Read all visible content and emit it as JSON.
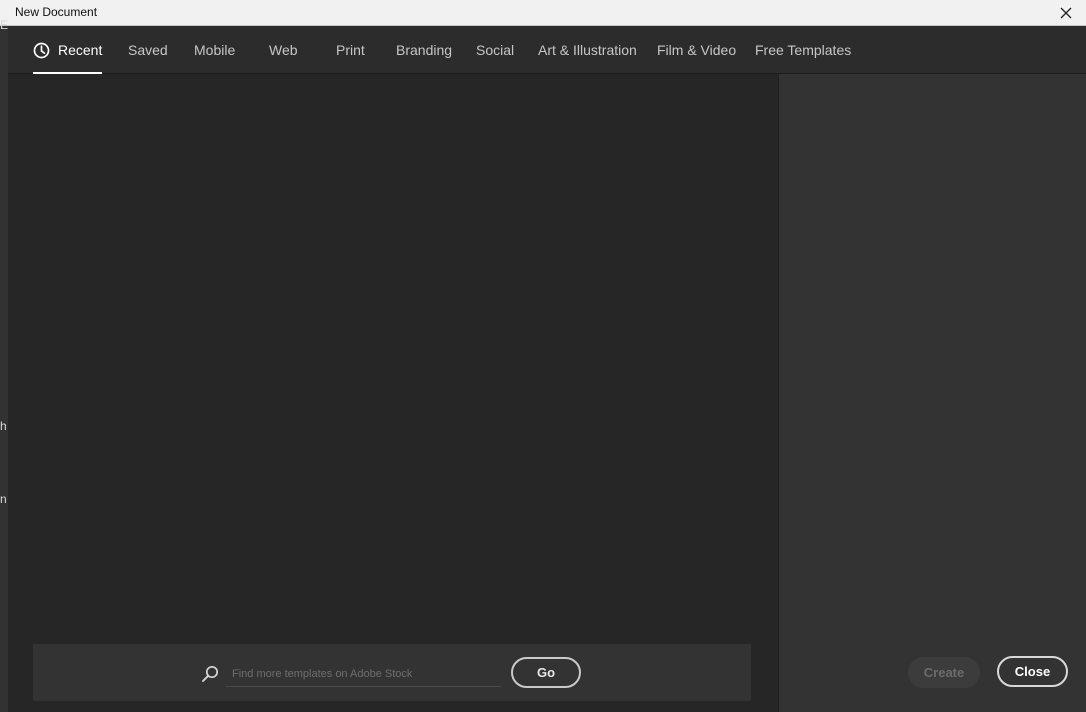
{
  "window": {
    "title": "New Document",
    "background_fragments": [
      "E",
      "h",
      "n"
    ]
  },
  "tabs": [
    {
      "label": "Recent",
      "icon": "clock-icon",
      "active": true
    },
    {
      "label": "Saved"
    },
    {
      "label": "Mobile"
    },
    {
      "label": "Web"
    },
    {
      "label": "Print"
    },
    {
      "label": "Branding"
    },
    {
      "label": "Social"
    },
    {
      "label": "Art & Illustration"
    },
    {
      "label": "Film & Video"
    },
    {
      "label": "Free Templates"
    }
  ],
  "search": {
    "placeholder": "Find more templates on Adobe Stock",
    "value": "",
    "go_label": "Go"
  },
  "actions": {
    "create_label": "Create",
    "close_label": "Close"
  },
  "colors": {
    "dialog_bg": "#262626",
    "panel_bg": "#333333",
    "tab_active": "#ffffff"
  }
}
